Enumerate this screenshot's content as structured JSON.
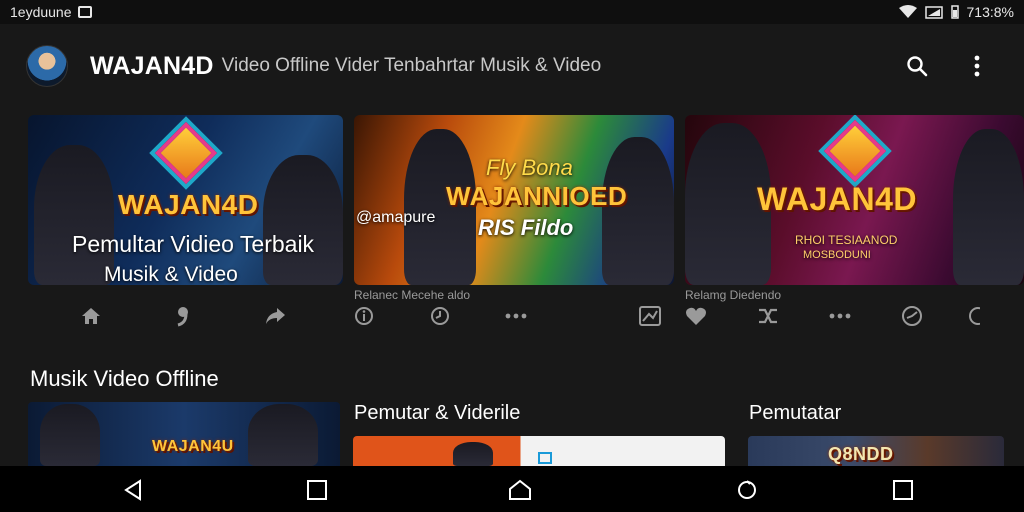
{
  "status_bar": {
    "carrier": "1eyduune",
    "battery": "713:8%"
  },
  "app_bar": {
    "title": "WAJAN4D",
    "subtitle": "Video Offline Vider Tenbahrtar Musik & Video"
  },
  "featured": {
    "card1": {
      "logo": "WAJAN4D",
      "caption_line1": "Pemultar Vidieo Terbaik",
      "caption_line2": "Musik & Video"
    },
    "card2": {
      "script": "Fly Bona",
      "logo": "WAJANNIOED",
      "tag": "@amapure",
      "sub": "RIS Fildo",
      "meta": "Relanec Mecehe aldo"
    },
    "card3": {
      "logo": "WAJAN4D",
      "sub1": "RHOI TESIAANOD",
      "sub2": "MOSBODUNI",
      "meta": "Relamg Diedendo"
    }
  },
  "sections": {
    "offline_title": "Musik Video Offline",
    "pemutar_title": "Pemutar & Viderile",
    "pemutatar_title": "Pemutatar",
    "thumb1_logo": "WAJAN4U",
    "thumb3_logo": "Q8NDD"
  },
  "colors": {
    "background": "#181818",
    "status_bar": "#0f0f0f",
    "nav_bar": "#000000",
    "logo_gold": "#ffc43a",
    "muted_icon": "#9a9a9a"
  },
  "icons": {
    "status": [
      "notification-box-icon",
      "wifi-icon",
      "signal-icon",
      "battery-icon"
    ],
    "app_bar": [
      "search-icon",
      "more-vert-icon"
    ],
    "card1_actions": [
      "home-icon",
      "reply-icon",
      "share-icon"
    ],
    "card2_actions": [
      "info-icon",
      "clock-icon",
      "more-horiz-icon",
      "image-icon"
    ],
    "card3_actions": [
      "heart-icon",
      "shuffle-icon",
      "more-horiz-icon",
      "speed-icon",
      "circle-icon"
    ],
    "nav": [
      "back-icon",
      "square-icon",
      "home-outline-icon",
      "recents-icon",
      "overview-icon"
    ]
  }
}
